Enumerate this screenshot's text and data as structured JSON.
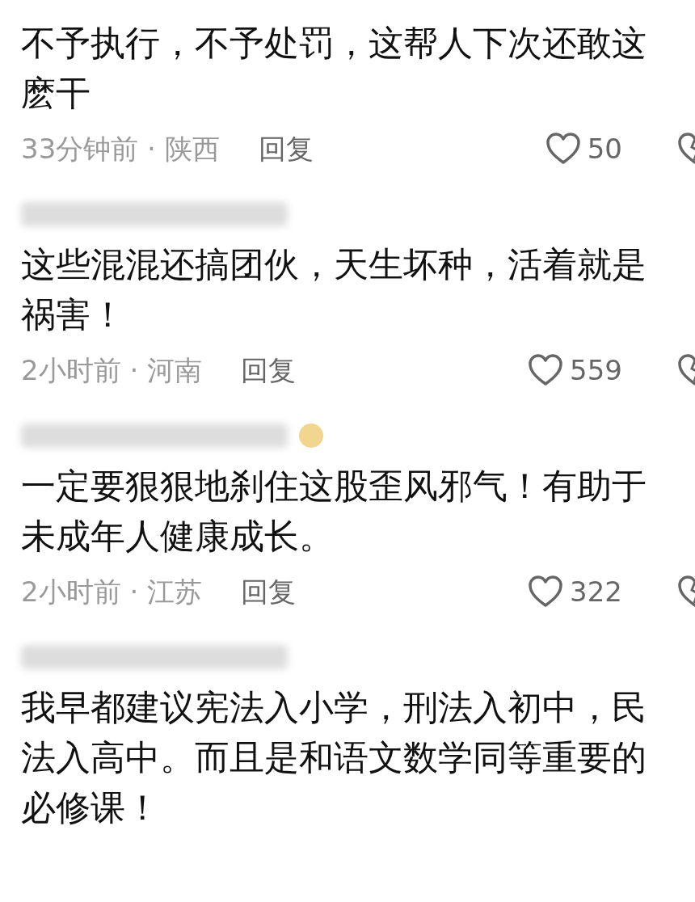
{
  "comments": [
    {
      "name_blurred": false,
      "badge": false,
      "text": "不予执行，不予处罚，这帮人下次还敢这麽干",
      "meta": "33分钟前 · 陕西",
      "reply": "回复",
      "likes": "50"
    },
    {
      "name_blurred": true,
      "badge": false,
      "text": "这些混混还搞团伙，天生坏种，活着就是祸害！",
      "meta": "2小时前 · 河南",
      "reply": "回复",
      "likes": "559"
    },
    {
      "name_blurred": true,
      "badge": true,
      "text": "一定要狠狠地刹住这股歪风邪气！有助于未成年人健康成长。",
      "meta": "2小时前 · 江苏",
      "reply": "回复",
      "likes": "322"
    },
    {
      "name_blurred": true,
      "badge": false,
      "text": "我早都建议宪法入小学，刑法入初中，民法入高中。而且是和语文数学同等重要的必修课！"
    }
  ]
}
